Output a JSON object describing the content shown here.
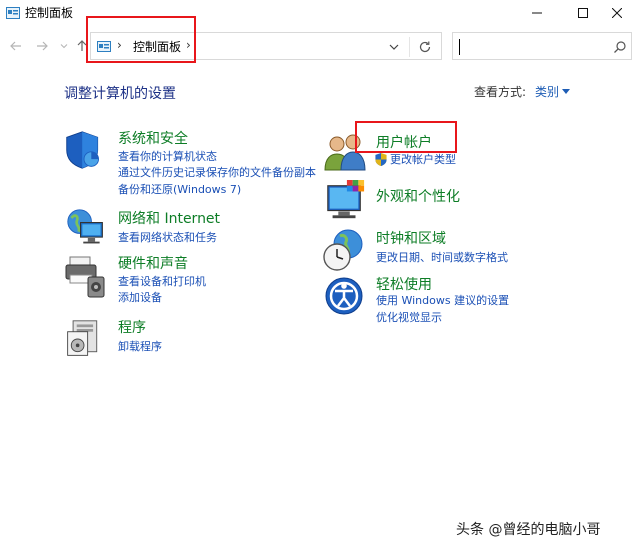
{
  "window": {
    "title": "控制面板"
  },
  "address": {
    "crumb": "控制面板",
    "search_placeholder": ""
  },
  "main": {
    "heading": "调整计算机的设置",
    "view_by_label": "查看方式:",
    "view_by_value": "类别"
  },
  "left_categories": [
    {
      "title": "系统和安全",
      "links": [
        "查看你的计算机状态",
        "通过文件历史记录保存你的文件备份副本",
        "备份和还原(Windows 7)"
      ]
    },
    {
      "title": "网络和 Internet",
      "links": [
        "查看网络状态和任务"
      ]
    },
    {
      "title": "硬件和声音",
      "links": [
        "查看设备和打印机",
        "添加设备"
      ]
    },
    {
      "title": "程序",
      "links": [
        "卸载程序"
      ]
    }
  ],
  "right_categories": [
    {
      "title": "用户帐户",
      "links": [
        "更改帐户类型"
      ]
    },
    {
      "title": "外观和个性化",
      "links": []
    },
    {
      "title": "时钟和区域",
      "links": [
        "更改日期、时间或数字格式"
      ]
    },
    {
      "title": "轻松使用",
      "links": [
        "使用 Windows 建议的设置",
        "优化视觉显示"
      ]
    }
  ],
  "watermark": "头条 @曾经的电脑小哥",
  "colors": {
    "heading": "#1e3287",
    "category_title": "#0d7d26",
    "link": "#1a4fb5",
    "highlight": "#e8161b"
  }
}
